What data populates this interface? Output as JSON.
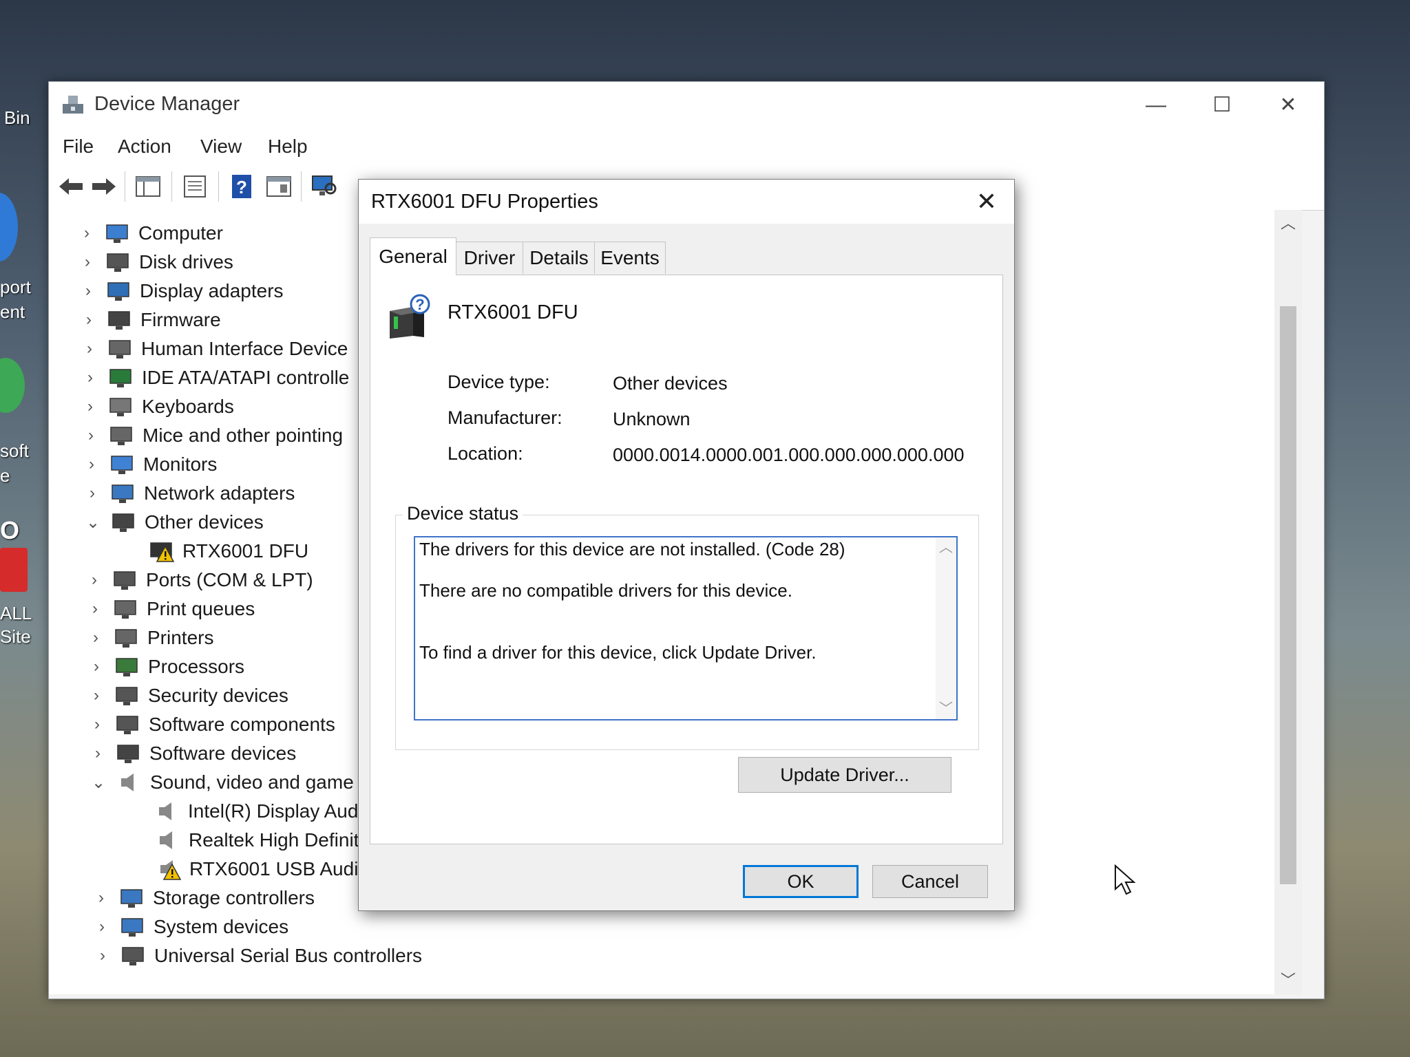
{
  "desktop": {
    "labels": [
      "Bin",
      "port",
      "ent",
      "soft",
      "e",
      "O",
      "ALL",
      "Site"
    ]
  },
  "window": {
    "title": "Device Manager",
    "menu": [
      "File",
      "Action",
      "View",
      "Help"
    ],
    "controls": {
      "minimize": "—",
      "maximize": "☐",
      "close": "✕"
    }
  },
  "tree": {
    "items": [
      {
        "label": "Computer",
        "expanded": false,
        "indent": 0,
        "icon": "computer-icon"
      },
      {
        "label": "Disk drives",
        "expanded": false,
        "indent": 0,
        "icon": "disk-drive-icon"
      },
      {
        "label": "Display adapters",
        "expanded": false,
        "indent": 0,
        "icon": "display-adapter-icon"
      },
      {
        "label": "Firmware",
        "expanded": false,
        "indent": 0,
        "icon": "firmware-icon"
      },
      {
        "label": "Human Interface Device",
        "expanded": false,
        "indent": 0,
        "icon": "hid-icon"
      },
      {
        "label": "IDE ATA/ATAPI controlle",
        "expanded": false,
        "indent": 0,
        "icon": "ide-controller-icon"
      },
      {
        "label": "Keyboards",
        "expanded": false,
        "indent": 0,
        "icon": "keyboard-icon"
      },
      {
        "label": "Mice and other pointing",
        "expanded": false,
        "indent": 0,
        "icon": "mouse-icon"
      },
      {
        "label": "Monitors",
        "expanded": false,
        "indent": 0,
        "icon": "monitor-icon"
      },
      {
        "label": "Network adapters",
        "expanded": false,
        "indent": 0,
        "icon": "network-adapter-icon"
      },
      {
        "label": "Other devices",
        "expanded": true,
        "indent": 0,
        "icon": "unknown-device-icon"
      },
      {
        "label": "RTX6001 DFU",
        "expanded": null,
        "indent": 1,
        "icon": "warning-device-icon"
      },
      {
        "label": "Ports (COM & LPT)",
        "expanded": false,
        "indent": 0,
        "icon": "port-icon"
      },
      {
        "label": "Print queues",
        "expanded": false,
        "indent": 0,
        "icon": "print-queue-icon"
      },
      {
        "label": "Printers",
        "expanded": false,
        "indent": 0,
        "icon": "printer-icon"
      },
      {
        "label": "Processors",
        "expanded": false,
        "indent": 0,
        "icon": "processor-icon"
      },
      {
        "label": "Security devices",
        "expanded": false,
        "indent": 0,
        "icon": "security-device-icon"
      },
      {
        "label": "Software components",
        "expanded": false,
        "indent": 0,
        "icon": "software-component-icon"
      },
      {
        "label": "Software devices",
        "expanded": false,
        "indent": 0,
        "icon": "software-device-icon"
      },
      {
        "label": "Sound, video and game",
        "expanded": true,
        "indent": 0,
        "icon": "speaker-icon"
      },
      {
        "label": "Intel(R) Display Audi",
        "expanded": null,
        "indent": 1,
        "icon": "speaker-icon"
      },
      {
        "label": "Realtek High Definit",
        "expanded": null,
        "indent": 1,
        "icon": "speaker-icon"
      },
      {
        "label": "RTX6001 USB Audio",
        "expanded": null,
        "indent": 1,
        "icon": "warning-speaker-icon"
      },
      {
        "label": "Storage controllers",
        "expanded": false,
        "indent": 0,
        "icon": "storage-controller-icon"
      },
      {
        "label": "System devices",
        "expanded": false,
        "indent": 0,
        "icon": "system-device-icon"
      },
      {
        "label": "Universal Serial Bus controllers",
        "expanded": false,
        "indent": 0,
        "icon": "usb-icon"
      }
    ]
  },
  "dialog": {
    "title": "RTX6001 DFU Properties",
    "close": "✕",
    "tabs": [
      "General",
      "Driver",
      "Details",
      "Events"
    ],
    "active_tab": "General",
    "device_name": "RTX6001 DFU",
    "properties": {
      "device_type_label": "Device type:",
      "device_type": "Other devices",
      "manufacturer_label": "Manufacturer:",
      "manufacturer": "Unknown",
      "location_label": "Location:",
      "location": "0000.0014.0000.001.000.000.000.000.000"
    },
    "status_group_title": "Device status",
    "status_lines": [
      "The drivers for this device are not installed. (Code 28)",
      "There are no compatible drivers for this device.",
      "To find a driver for this device, click Update Driver."
    ],
    "update_driver_label": "Update Driver...",
    "ok_label": "OK",
    "cancel_label": "Cancel"
  },
  "colors": {
    "accent": "#0078d7",
    "status_border": "#3f73c8",
    "warning": "#f2c200"
  }
}
